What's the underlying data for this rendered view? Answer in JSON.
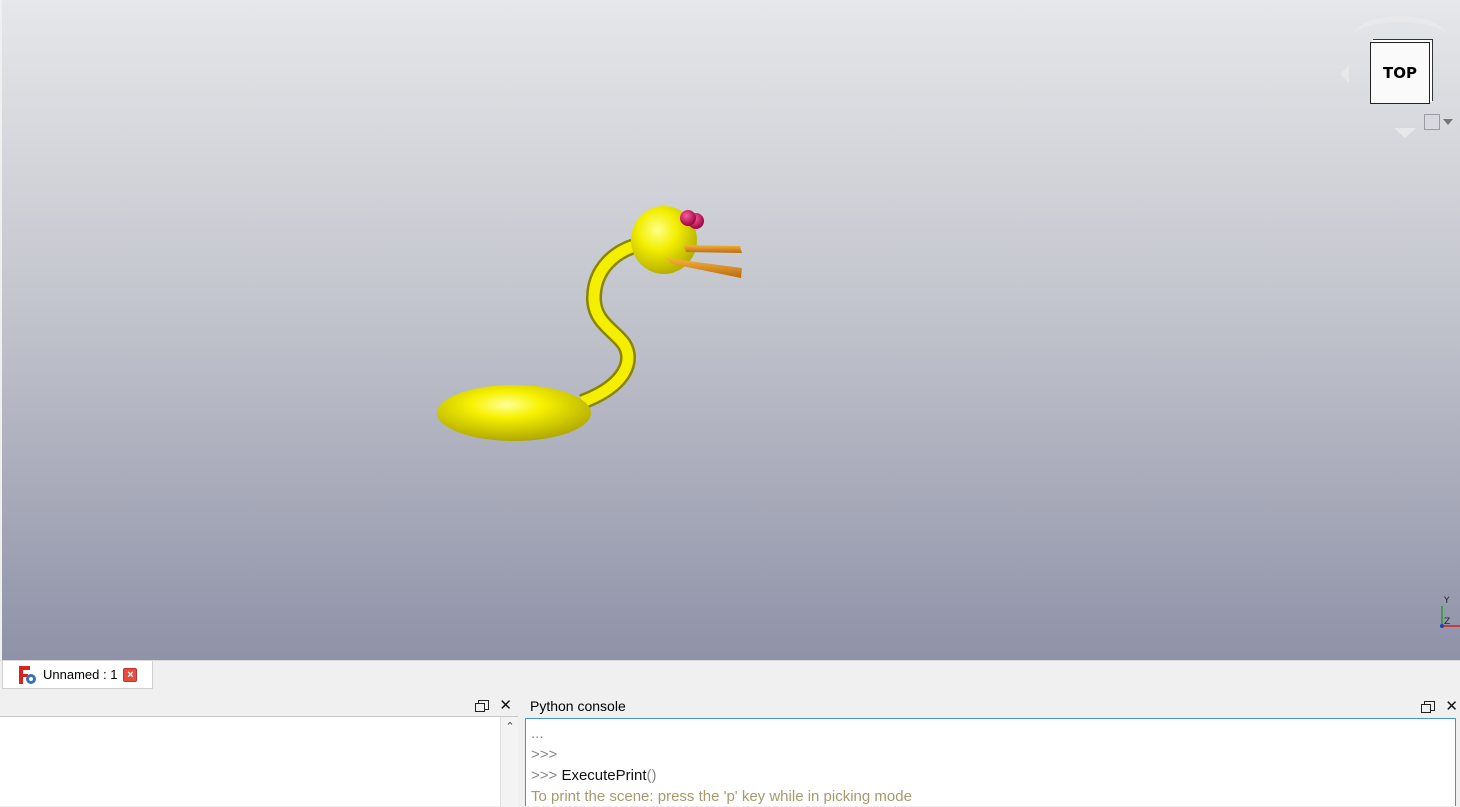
{
  "viewport": {
    "navcube_face_label": "TOP",
    "axis_labels": {
      "y": "Y",
      "z": "Z"
    },
    "colors": {
      "model_body": "#f2f000",
      "model_beak": "#e8951e",
      "model_eyes": "#d81060"
    }
  },
  "tabs": [
    {
      "label": "Unnamed : 1",
      "icon": "freecad-icon",
      "close_icon": "close-tab-icon"
    }
  ],
  "left_panel": {
    "title": "",
    "float_icon": "float-panel-icon",
    "close_icon": "close-icon"
  },
  "python_console": {
    "title": "Python console",
    "lines": [
      {
        "prompt": "...",
        "code": "",
        "paren": ""
      },
      {
        "prompt": ">>>",
        "code": "",
        "paren": ""
      },
      {
        "prompt": ">>> ",
        "code": "ExecutePrint",
        "paren": "()"
      }
    ],
    "output": "To print the scene: press the 'p' key while in picking mode"
  }
}
